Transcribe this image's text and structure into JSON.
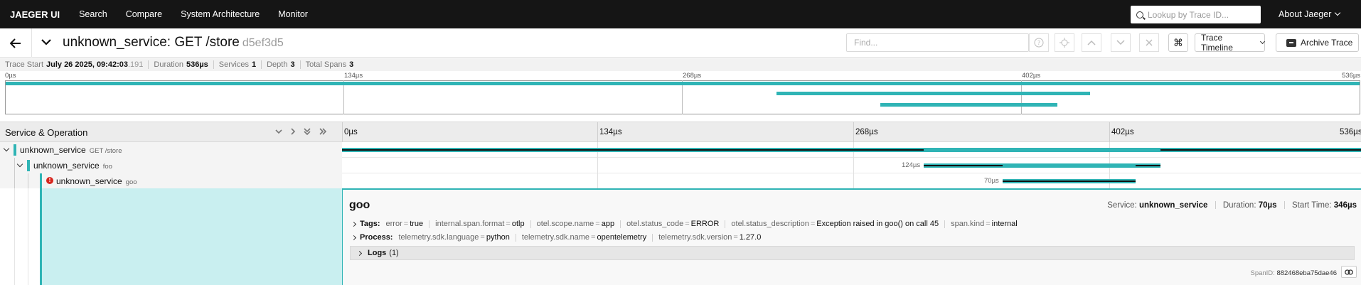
{
  "topnav": {
    "brand": "JAEGER UI",
    "items": [
      "Search",
      "Compare",
      "System Architecture",
      "Monitor"
    ],
    "search_placeholder": "Lookup by Trace ID...",
    "about": "About Jaeger"
  },
  "header": {
    "title": "unknown_service: GET /store",
    "trace_id": "d5ef3d5",
    "find_placeholder": "Find...",
    "timeline_button": "Trace Timeline",
    "archive_button": "Archive Trace",
    "kbd_icon": "⌘"
  },
  "meta": {
    "trace_start_label": "Trace Start",
    "trace_start_value": "July 26 2025, 09:42:03",
    "trace_start_ms": ".191",
    "duration_label": "Duration",
    "duration_value": "536µs",
    "services_label": "Services",
    "services_value": "1",
    "depth_label": "Depth",
    "depth_value": "3",
    "total_spans_label": "Total Spans",
    "total_spans_value": "3"
  },
  "minimap": {
    "ticks": [
      "0µs",
      "134µs",
      "268µs",
      "402µs",
      "536µs"
    ]
  },
  "span_table": {
    "column_title": "Service & Operation",
    "ticks": [
      "0µs",
      "134µs",
      "268µs",
      "402µs",
      "536µs"
    ],
    "rows": [
      {
        "service": "unknown_service",
        "operation": "GET /store",
        "duration": ""
      },
      {
        "service": "unknown_service",
        "operation": "foo",
        "duration": "124µs"
      },
      {
        "service": "unknown_service",
        "operation": "goo",
        "duration": "70µs"
      }
    ]
  },
  "detail": {
    "title": "goo",
    "service_label": "Service:",
    "service_value": "unknown_service",
    "duration_label": "Duration:",
    "duration_value": "70µs",
    "start_label": "Start Time:",
    "start_value": "346µs",
    "tags_label": "Tags:",
    "tags": [
      {
        "k": "error",
        "v": "true"
      },
      {
        "k": "internal.span.format",
        "v": "otlp"
      },
      {
        "k": "otel.scope.name",
        "v": "app"
      },
      {
        "k": "otel.status_code",
        "v": "ERROR"
      },
      {
        "k": "otel.status_description",
        "v": "Exception raised in goo() on call 45"
      },
      {
        "k": "span.kind",
        "v": "internal"
      }
    ],
    "process_label": "Process:",
    "process": [
      {
        "k": "telemetry.sdk.language",
        "v": "python"
      },
      {
        "k": "telemetry.sdk.name",
        "v": "opentelemetry"
      },
      {
        "k": "telemetry.sdk.version",
        "v": "1.27.0"
      }
    ],
    "logs_label": "Logs",
    "logs_count": "(1)",
    "span_id_label": "SpanID:",
    "span_id_value": "882468eba75dae46"
  },
  "colors": {
    "accent": "#2fb4b5",
    "error": "#d7261e",
    "nav": "#151515"
  }
}
